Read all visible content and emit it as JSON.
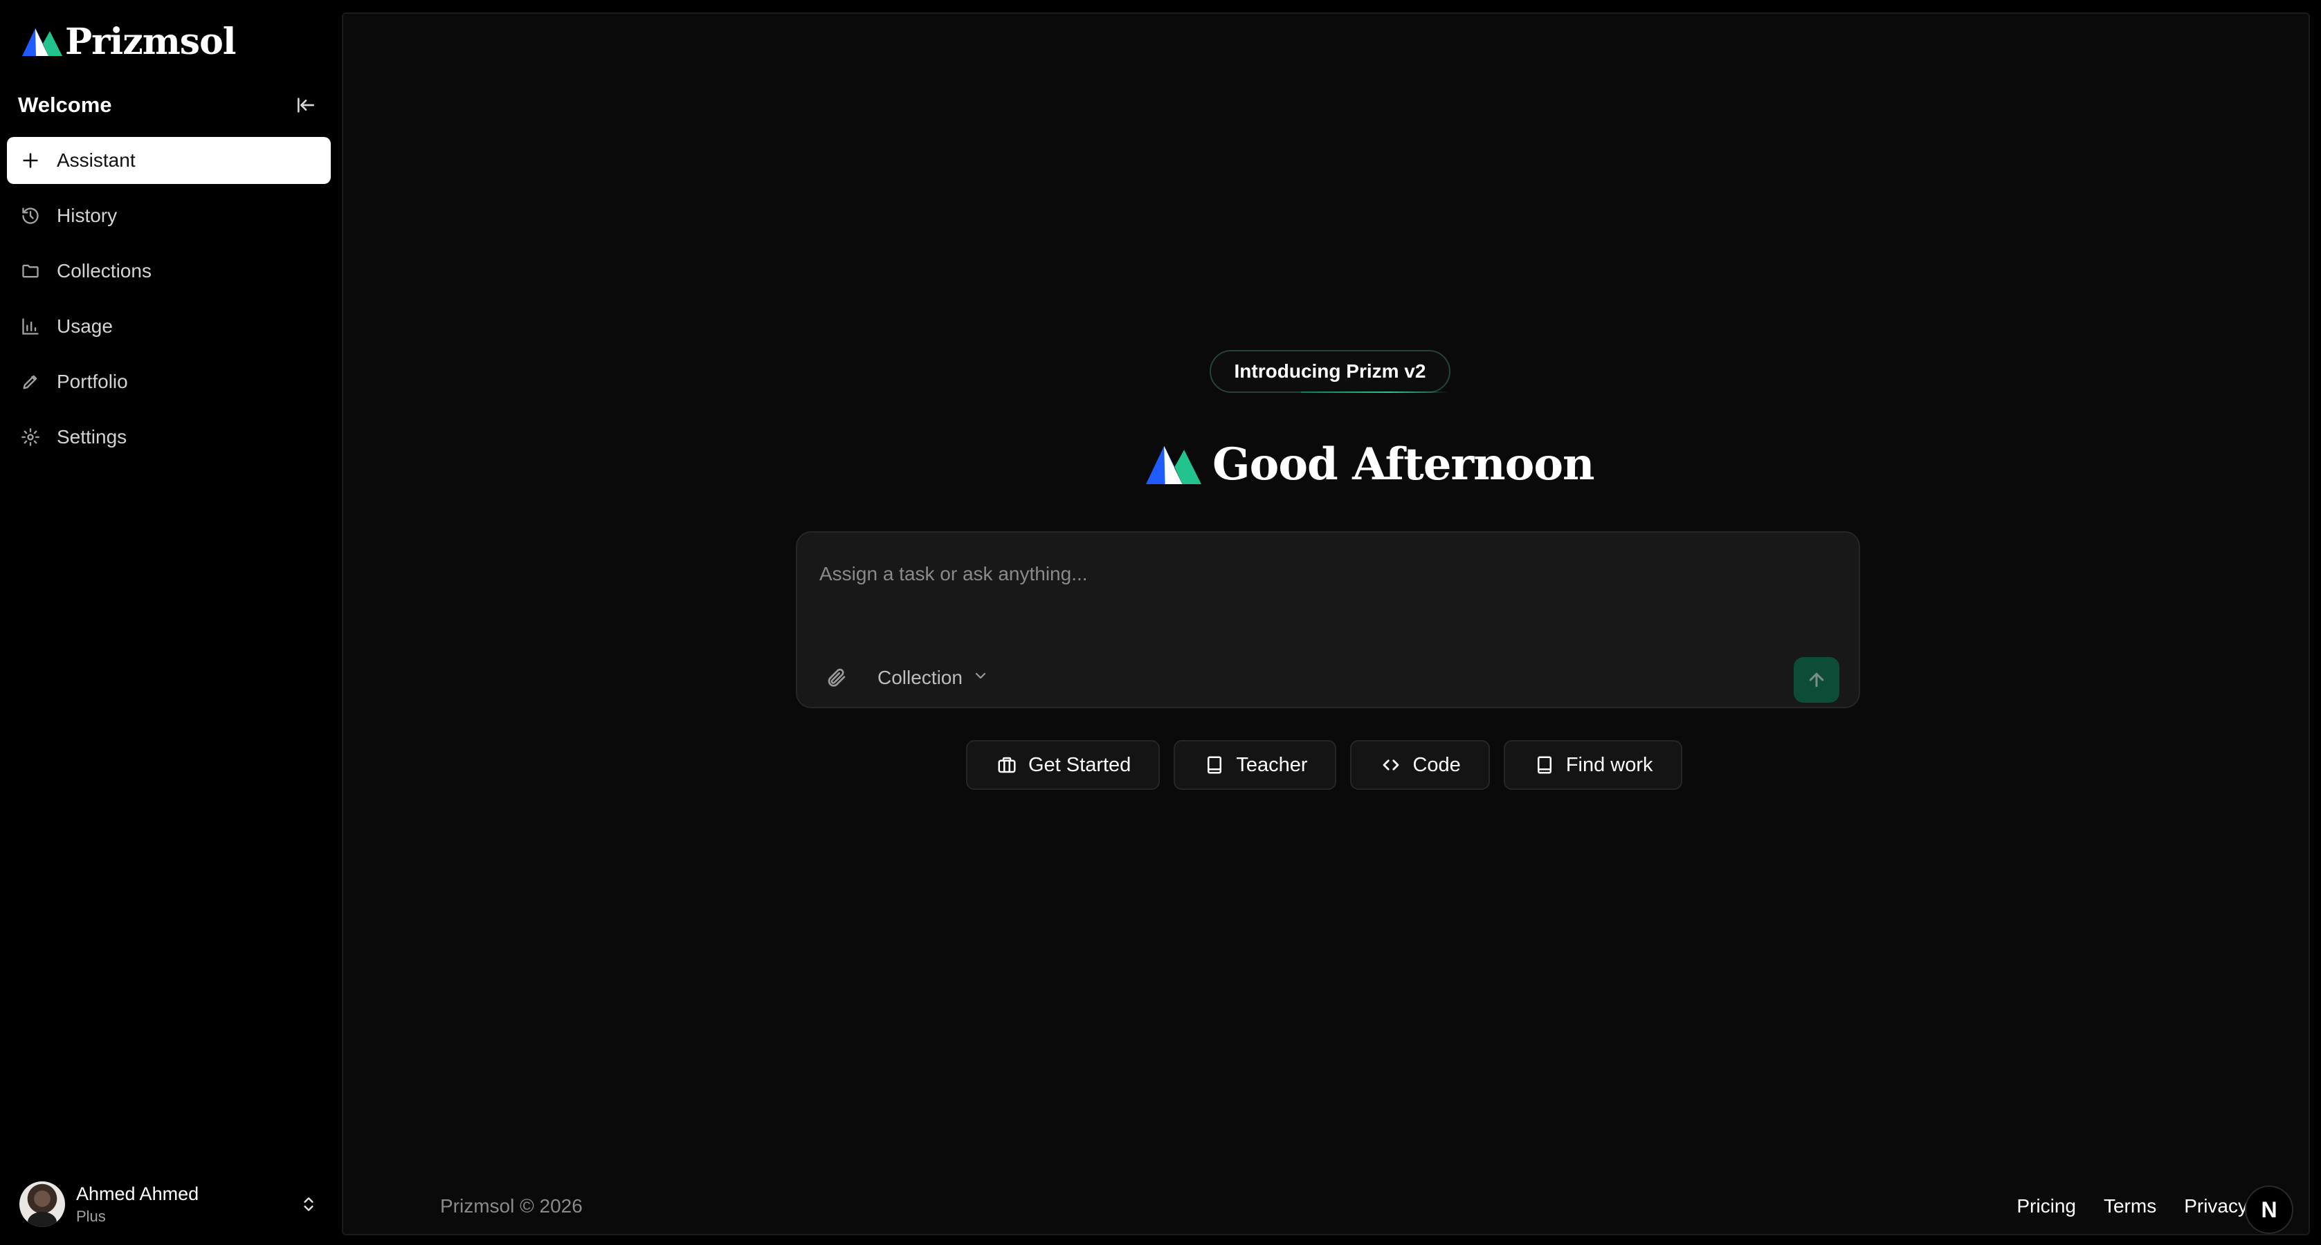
{
  "brand": {
    "name": "Prizmsol",
    "logo_icon": "prism-logo-icon"
  },
  "sidebar": {
    "title": "Welcome",
    "collapse_icon": "collapse-sidebar-icon",
    "items": [
      {
        "label": "Assistant",
        "icon": "plus-icon",
        "active": true
      },
      {
        "label": "History",
        "icon": "history-icon",
        "active": false
      },
      {
        "label": "Collections",
        "icon": "folder-icon",
        "active": false
      },
      {
        "label": "Usage",
        "icon": "bar-chart-icon",
        "active": false
      },
      {
        "label": "Portfolio",
        "icon": "pen-icon",
        "active": false
      },
      {
        "label": "Settings",
        "icon": "gear-icon",
        "active": false
      }
    ],
    "user": {
      "name": "Ahmed Ahmed",
      "plan": "Plus"
    }
  },
  "main": {
    "intro_pill": "Introducing Prizm v2",
    "greeting": "Good Afternoon",
    "composer": {
      "placeholder": "Assign a task or ask anything...",
      "value": "",
      "collection_label": "Collection"
    },
    "chips": [
      {
        "label": "Get Started",
        "icon": "briefcase-icon"
      },
      {
        "label": "Teacher",
        "icon": "book-icon"
      },
      {
        "label": "Code",
        "icon": "code-icon"
      },
      {
        "label": "Find work",
        "icon": "book-icon"
      }
    ],
    "footer": {
      "copyright": "Prizmsol © 2026",
      "links": [
        "Pricing",
        "Terms",
        "Privacy"
      ],
      "badge": "N"
    }
  },
  "colors": {
    "background": "#000000",
    "panel": "#0a0a0a",
    "accent_green": "#0d4d37",
    "logo_blue": "#1f5bff",
    "logo_green": "#22c38e"
  }
}
